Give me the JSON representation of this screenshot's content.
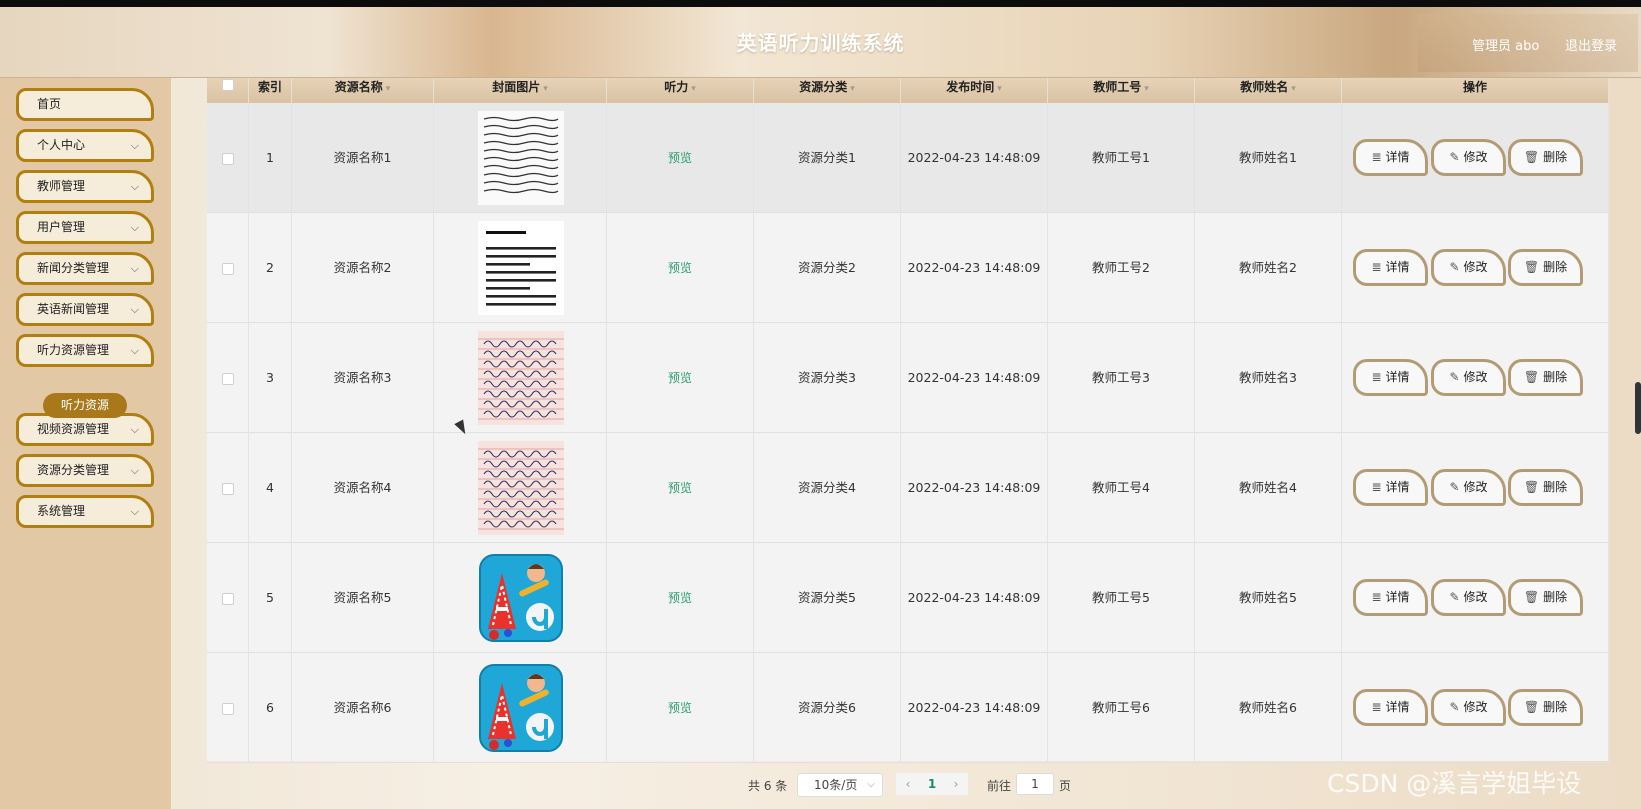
{
  "header": {
    "title": "英语听力训练系统",
    "user": "管理员 abo",
    "logout": "退出登录"
  },
  "sidebar": {
    "items": [
      {
        "label": "首页",
        "has_chevron": false
      },
      {
        "label": "个人中心",
        "has_chevron": true
      },
      {
        "label": "教师管理",
        "has_chevron": true
      },
      {
        "label": "用户管理",
        "has_chevron": true
      },
      {
        "label": "新闻分类管理",
        "has_chevron": true
      },
      {
        "label": "英语新闻管理",
        "has_chevron": true
      },
      {
        "label": "听力资源管理",
        "has_chevron": true
      },
      {
        "label": "视频资源管理",
        "has_chevron": true
      },
      {
        "label": "资源分类管理",
        "has_chevron": true
      },
      {
        "label": "系统管理",
        "has_chevron": true
      }
    ],
    "active_sub": "听力资源",
    "chevron": "⌵"
  },
  "table": {
    "headers": [
      "索引",
      "资源名称",
      "封面图片",
      "听力",
      "资源分类",
      "发布时间",
      "教师工号",
      "教师姓名",
      "操作"
    ],
    "rows": [
      {
        "index": "1",
        "name": "资源名称1",
        "cover": "handwriting-sheet",
        "audio": "预览",
        "category": "资源分类1",
        "time": "2022-04-23 14:48:09",
        "teacher_no": "教师工号1",
        "teacher_name": "教师姓名1"
      },
      {
        "index": "2",
        "name": "资源名称2",
        "cover": "printed-text",
        "audio": "预览",
        "category": "资源分类2",
        "time": "2022-04-23 14:48:09",
        "teacher_no": "教师工号2",
        "teacher_name": "教师姓名2"
      },
      {
        "index": "3",
        "name": "资源名称3",
        "cover": "cursive-alphabet",
        "audio": "预览",
        "category": "资源分类3",
        "time": "2022-04-23 14:48:09",
        "teacher_no": "教师工号3",
        "teacher_name": "教师姓名3"
      },
      {
        "index": "4",
        "name": "资源名称4",
        "cover": "cursive-alphabet",
        "audio": "预览",
        "category": "资源分类4",
        "time": "2022-04-23 14:48:09",
        "teacher_no": "教师工号4",
        "teacher_name": "教师姓名4"
      },
      {
        "index": "5",
        "name": "资源名称5",
        "cover": "aa-app-icon",
        "audio": "预览",
        "category": "资源分类5",
        "time": "2022-04-23 14:48:09",
        "teacher_no": "教师工号5",
        "teacher_name": "教师姓名5"
      },
      {
        "index": "6",
        "name": "资源名称6",
        "cover": "aa-app-icon",
        "audio": "预览",
        "category": "资源分类6",
        "time": "2022-04-23 14:48:09",
        "teacher_no": "教师工号6",
        "teacher_name": "教师姓名6"
      }
    ],
    "actions": {
      "detail": "详情",
      "edit": "修改",
      "delete": "删除"
    },
    "icons": {
      "detail": "≣",
      "edit": "✎",
      "delete": "🗑",
      "sort": "▾"
    }
  },
  "pager": {
    "total": "共 6 条",
    "page_size": "10条/页",
    "prev": "‹",
    "current": "1",
    "next": "›",
    "goto": "前往",
    "goto_value": "1",
    "page_unit": "页",
    "dropdown": "⌵"
  },
  "watermark": "CSDN @溪言学姐毕设",
  "colors": {
    "menu_border": "#b07f10",
    "active_sub": "#a9781b",
    "preview": "#2a9d6e",
    "btn_border": "#b39b75"
  }
}
